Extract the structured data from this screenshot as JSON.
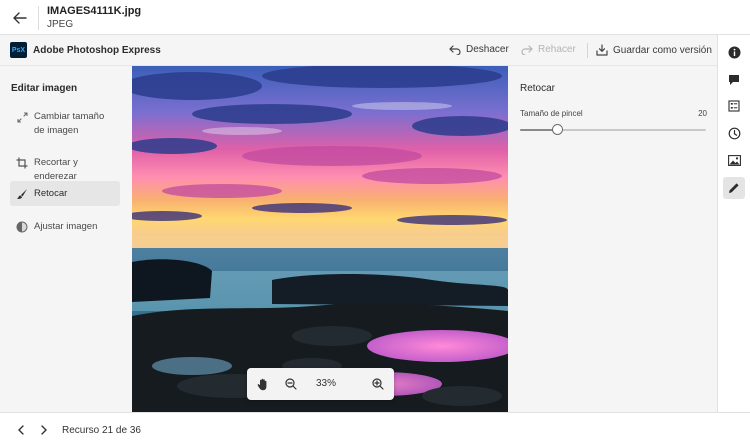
{
  "header": {
    "file_name": "IMAGES4111K.jpg",
    "file_type": "JPEG"
  },
  "appbar": {
    "app_name": "Adobe Photoshop Express",
    "logo_text": "PsX",
    "undo_label": "Deshacer",
    "redo_label": "Rehacer",
    "save_label": "Guardar como versión"
  },
  "left_panel": {
    "title": "Editar imagen",
    "items": [
      {
        "label": "Cambiar tamaño de imagen",
        "icon": "resize-icon",
        "active": false
      },
      {
        "label": "Recortar y enderezar",
        "icon": "crop-icon",
        "active": false
      },
      {
        "label": "Retocar",
        "icon": "brush-icon",
        "active": true
      },
      {
        "label": "Ajustar imagen",
        "icon": "adjust-icon",
        "active": false
      }
    ]
  },
  "settings": {
    "title": "Retocar",
    "brush_size_label": "Tamaño de pincel",
    "brush_size_value": "20",
    "brush_size_fraction": 0.2
  },
  "zoom": {
    "value": "33%"
  },
  "footer": {
    "counter": "Recurso 21 de 36"
  },
  "right_rail": {
    "icons": [
      "info-icon",
      "comment-icon",
      "properties-icon",
      "history-icon",
      "image-icon",
      "edit-icon"
    ],
    "active_icon": "edit-icon"
  },
  "colors": {
    "panel_bg": "#f5f5f5",
    "logo_bg": "#001e36",
    "logo_text": "#31a8ff"
  }
}
